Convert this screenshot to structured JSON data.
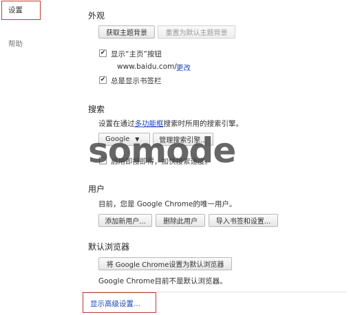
{
  "nav": {
    "settings": "设置",
    "help": "帮助"
  },
  "appearance": {
    "title": "外观",
    "get_themes_button": "获取主题背景",
    "reset_theme_button": "重置为默认主题背景",
    "show_home_button_label": "显示“主页”按钮",
    "home_page_url": "www.baidu.com/",
    "change_link": "更改",
    "show_bookmarks_bar_label": "总是显示书签栏"
  },
  "search": {
    "title": "搜索",
    "desc_before": "设置在通过",
    "desc_link": "多功能框",
    "desc_after": "搜索时所用的搜索引擎。",
    "engine_selected": "Google",
    "manage_button": "管理搜索引擎...",
    "instant_label_visible": "启用即搜即得，加快搜索速度。"
  },
  "users": {
    "title": "用户",
    "desc": "目前，您是 Google Chrome的唯一用户。",
    "add_user_button": "添加新用户...",
    "delete_user_button": "删除此用户",
    "import_button": "导入书签和设置..."
  },
  "default_browser": {
    "title": "默认浏览器",
    "make_default_button": "将 Google Chrome设置为默认浏览器",
    "status": "Google Chrome目前不是默认浏览器。"
  },
  "advanced_link": "显示高级设置...",
  "watermark": "somode",
  "colors": {
    "highlight": "#c0392b",
    "link": "#1a47b8"
  }
}
